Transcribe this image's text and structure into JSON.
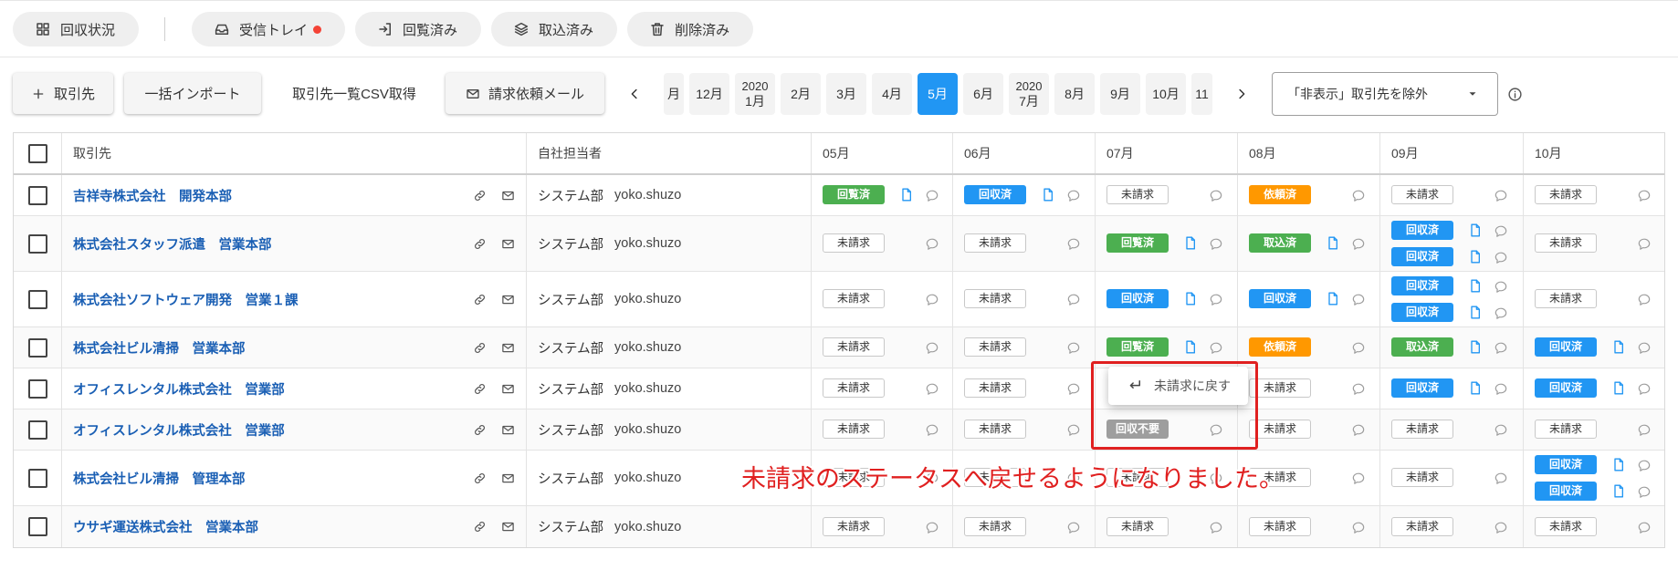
{
  "tabs": [
    {
      "label": "回収状況",
      "icon": "grid-icon"
    },
    {
      "label": "受信トレイ",
      "icon": "inbox-icon",
      "notification_dot": true
    },
    {
      "label": "回覧済み",
      "icon": "arrow-into-box-icon"
    },
    {
      "label": "取込済み",
      "icon": "layers-icon"
    },
    {
      "label": "削除済み",
      "icon": "trash-icon"
    }
  ],
  "toolbar": {
    "add_partner_label": "取引先",
    "bulk_import_label": "一括インポート",
    "csv_export_label": "取引先一覧CSV取得",
    "request_mail_label": "請求依頼メール"
  },
  "month_nav": {
    "items": [
      {
        "label": "月"
      },
      {
        "label": "12月"
      },
      {
        "year": "2020",
        "label": "1月"
      },
      {
        "label": "2月"
      },
      {
        "label": "3月"
      },
      {
        "label": "4月"
      },
      {
        "label": "5月",
        "active": true
      },
      {
        "label": "6月"
      },
      {
        "year": "2020",
        "label": "7月"
      },
      {
        "label": "8月"
      },
      {
        "label": "9月"
      },
      {
        "label": "10月"
      },
      {
        "label": "11"
      }
    ]
  },
  "filter": {
    "selected": "「非表示」取引先を除外"
  },
  "table": {
    "headers": {
      "partner": "取引先",
      "owner": "自社担当者",
      "months": [
        "05月",
        "06月",
        "07月",
        "08月",
        "09月",
        "10月"
      ]
    },
    "rows": [
      {
        "partner": "吉祥寺株式会社　開発本部",
        "dept": "システム部",
        "user": "yoko.shuzo",
        "cells": [
          [
            {
              "status": "回覧済",
              "document": true,
              "comment": true
            }
          ],
          [
            {
              "status": "回収済",
              "document": true,
              "comment": true
            }
          ],
          [
            {
              "status": "未請求",
              "comment": true
            }
          ],
          [
            {
              "status": "依頼済",
              "comment": true
            }
          ],
          [
            {
              "status": "未請求",
              "comment": true
            }
          ],
          [
            {
              "status": "未請求",
              "comment": true
            }
          ]
        ]
      },
      {
        "partner": "株式会社スタッフ派遣　営業本部",
        "dept": "システム部",
        "user": "yoko.shuzo",
        "cells": [
          [
            {
              "status": "未請求",
              "comment": true
            }
          ],
          [
            {
              "status": "未請求",
              "comment": true
            }
          ],
          [
            {
              "status": "回覧済",
              "document": true,
              "comment": true
            }
          ],
          [
            {
              "status": "取込済",
              "document": true,
              "comment": true
            }
          ],
          [
            {
              "status": "回収済",
              "document": true,
              "comment": true
            },
            {
              "status": "回収済",
              "document": true,
              "comment": true
            }
          ],
          [
            {
              "status": "未請求",
              "comment": true
            }
          ]
        ]
      },
      {
        "partner": "株式会社ソフトウェア開発　営業１課",
        "dept": "システム部",
        "user": "yoko.shuzo",
        "cells": [
          [
            {
              "status": "未請求",
              "comment": true
            }
          ],
          [
            {
              "status": "未請求",
              "comment": true
            }
          ],
          [
            {
              "status": "回収済",
              "document": true,
              "comment": true
            }
          ],
          [
            {
              "status": "回収済",
              "document": true,
              "comment": true
            }
          ],
          [
            {
              "status": "回収済",
              "document": true,
              "comment": true
            },
            {
              "status": "回収済",
              "document": true,
              "comment": true
            }
          ],
          [
            {
              "status": "未請求",
              "comment": true
            }
          ]
        ]
      },
      {
        "partner": "株式会社ビル清掃　営業本部",
        "dept": "システム部",
        "user": "yoko.shuzo",
        "cells": [
          [
            {
              "status": "未請求",
              "comment": true
            }
          ],
          [
            {
              "status": "未請求",
              "comment": true
            }
          ],
          [
            {
              "status": "回覧済",
              "document": true,
              "comment": true
            }
          ],
          [
            {
              "status": "依頼済",
              "comment": true
            }
          ],
          [
            {
              "status": "取込済",
              "document": true,
              "comment": true
            }
          ],
          [
            {
              "status": "回収済",
              "document": true,
              "comment": true
            }
          ]
        ]
      },
      {
        "partner": "オフィスレンタル株式会社　営業部",
        "dept": "システム部",
        "user": "yoko.shuzo",
        "cells": [
          [
            {
              "status": "未請求",
              "comment": true
            }
          ],
          [
            {
              "status": "未請求",
              "comment": true
            }
          ],
          [],
          [
            {
              "status": "未請求",
              "comment": true
            }
          ],
          [
            {
              "status": "回収済",
              "document": true,
              "comment": true
            }
          ],
          [
            {
              "status": "回収済",
              "document": true,
              "comment": true
            }
          ]
        ]
      },
      {
        "partner": "オフィスレンタル株式会社　営業部",
        "dept": "システム部",
        "user": "yoko.shuzo",
        "cells": [
          [
            {
              "status": "未請求",
              "comment": true
            }
          ],
          [
            {
              "status": "未請求",
              "comment": true
            }
          ],
          [
            {
              "status": "回収不要",
              "comment": true
            }
          ],
          [
            {
              "status": "未請求",
              "comment": true
            }
          ],
          [
            {
              "status": "未請求",
              "comment": true
            }
          ],
          [
            {
              "status": "未請求",
              "comment": true
            }
          ]
        ]
      },
      {
        "partner": "株式会社ビル清掃　管理本部",
        "dept": "システム部",
        "user": "yoko.shuzo",
        "cells": [
          [
            {
              "status": "未請求",
              "comment": true
            }
          ],
          [
            {
              "status": "未請求",
              "comment": true
            }
          ],
          [
            {
              "status": "未請求",
              "comment": true
            }
          ],
          [
            {
              "status": "未請求",
              "comment": true
            }
          ],
          [
            {
              "status": "未請求",
              "comment": true
            }
          ],
          [
            {
              "status": "回収済",
              "document": true,
              "comment": true
            },
            {
              "status": "回収済",
              "document": true,
              "comment": true
            }
          ]
        ]
      },
      {
        "partner": "ウサギ運送株式会社　営業本部",
        "dept": "システム部",
        "user": "yoko.shuzo",
        "cells": [
          [
            {
              "status": "未請求",
              "comment": true
            }
          ],
          [
            {
              "status": "未請求",
              "comment": true
            }
          ],
          [
            {
              "status": "未請求",
              "comment": true
            }
          ],
          [
            {
              "status": "未請求",
              "comment": true
            }
          ],
          [
            {
              "status": "未請求",
              "comment": true
            }
          ],
          [
            {
              "status": "未請求",
              "comment": true
            }
          ]
        ]
      }
    ]
  },
  "context_menu": {
    "item_label": "未請求に戻す"
  },
  "annotation": {
    "text": "未請求のステータスへ戻せるようになりました。"
  },
  "colors": {
    "accent": "#2196f3",
    "annotation": "#e02020",
    "notification_dot": "#f44336",
    "status": {
      "回覧済": "#4caf50",
      "取込済": "#4caf50",
      "回収済": "#2196f3",
      "依頼済": "#ff9800",
      "回収不要": "#9e9e9e"
    }
  }
}
